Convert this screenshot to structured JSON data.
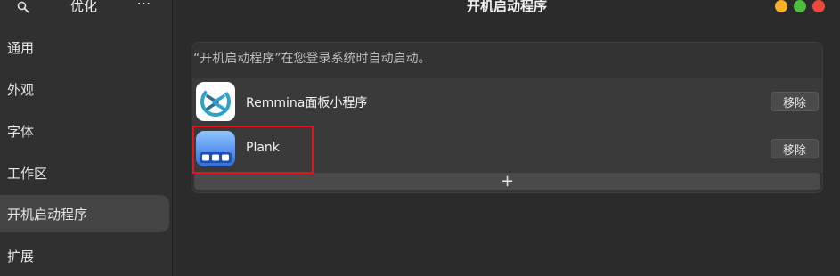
{
  "sidebar": {
    "title": "优化",
    "menu_glyph": "⋯",
    "items": [
      {
        "label": "通用"
      },
      {
        "label": "外观"
      },
      {
        "label": "字体"
      },
      {
        "label": "工作区"
      },
      {
        "label": "开机启动程序",
        "active": true
      },
      {
        "label": "扩展"
      }
    ]
  },
  "header": {
    "title": "开机启动程序"
  },
  "window_controls": {
    "colors": [
      "#f7b028",
      "#4dbf3c",
      "#ec4a3c"
    ]
  },
  "main": {
    "description": "“开机启动程序”在您登录系统时自动启动。",
    "apps": [
      {
        "name": "Remmina面板小程序",
        "icon": "remmina-icon",
        "remove_label": "移除"
      },
      {
        "name": "Plank",
        "icon": "plank-icon",
        "remove_label": "移除"
      }
    ],
    "add_label": "+"
  },
  "colors": {
    "highlight": "#e3141d",
    "sidebar_active": "#454545"
  }
}
